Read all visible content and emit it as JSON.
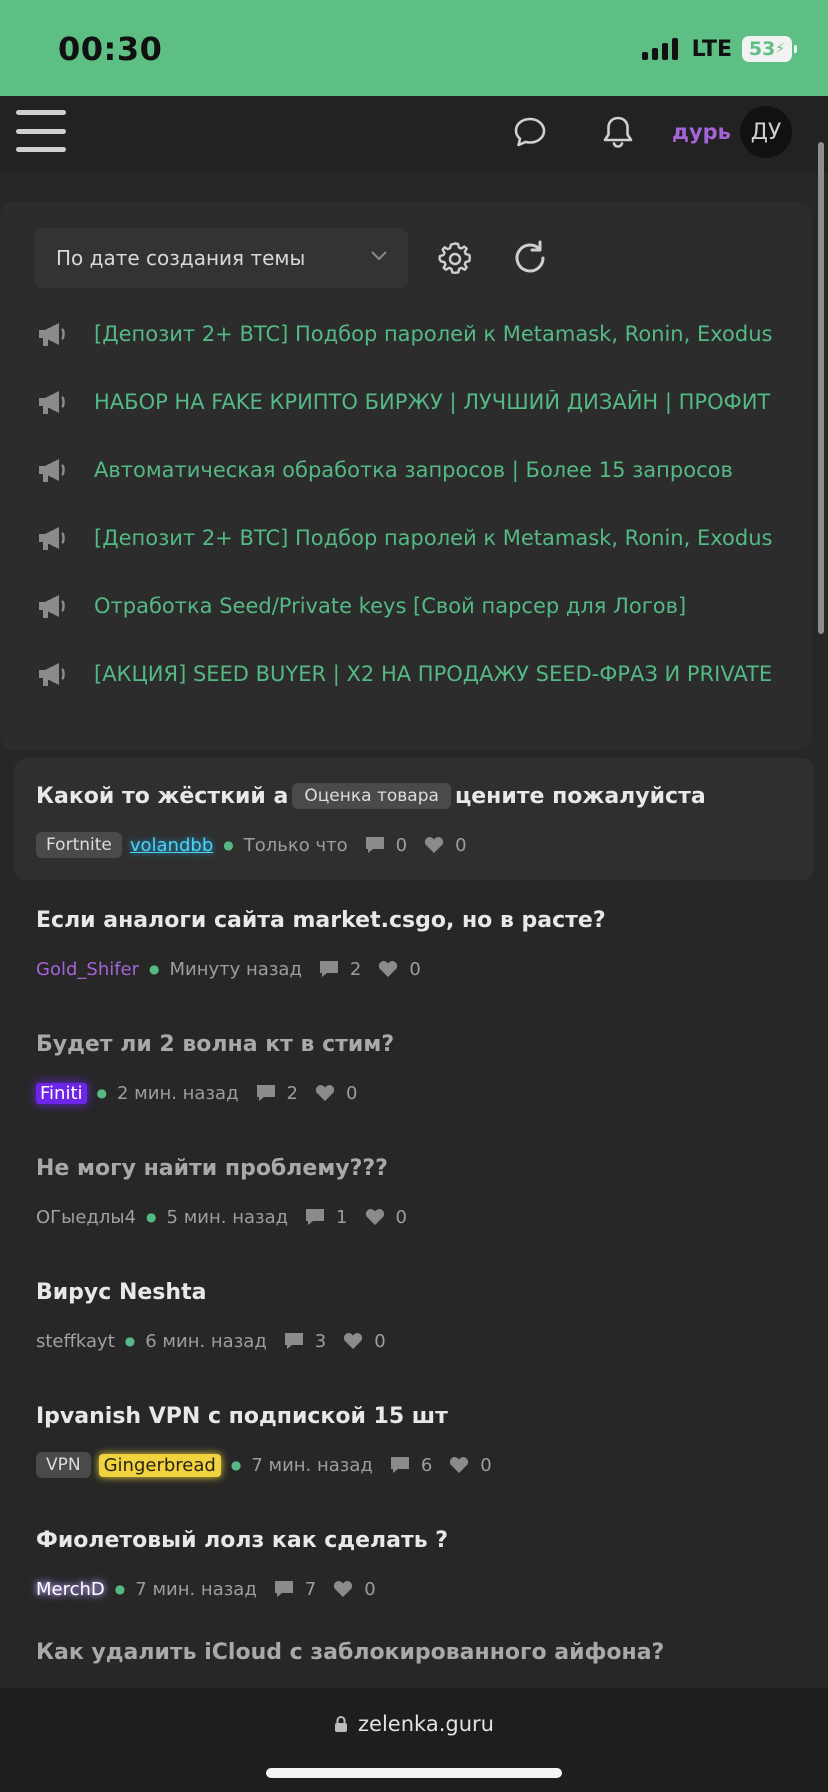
{
  "status_bar": {
    "time": "00:30",
    "network": "LTE",
    "battery": "53"
  },
  "header": {
    "username": "дурь",
    "avatar_initials": "ДУ"
  },
  "sort": {
    "label": "По дате создания темы"
  },
  "pinned": [
    "[Депозит 2+ BTC] Подбор паролей к Metamask, Ronin, Exodus",
    "НАБОР НА FAKE КРИПТО БИРЖУ | ЛУЧШИЙ ДИЗАЙН | ПРОФИТ",
    "Автоматическая обработка запросов | Более 15 запросов",
    "[Депозит 2+ BTC] Подбор паролей к Metamask, Ronin, Exodus",
    "Отработка Seed/Private keys [Свой парсер для Логов]",
    "[АКЦИЯ] SEED BUYER | X2 НА ПРОДАЖУ SEED-ФРАЗ И PRIVATE"
  ],
  "threads": [
    {
      "title_before": "Какой то жёсткий а",
      "inline_tag": "Оценка товара",
      "title_after": "цените пожалуйста",
      "tag": "Fortnite",
      "author": "volandbb",
      "time": "Только что",
      "replies": "0",
      "likes": "0"
    },
    {
      "title": "Если аналоги сайта market.csgo, но в расте?",
      "author": "Gold_Shifer",
      "time": "Минуту назад",
      "replies": "2",
      "likes": "0"
    },
    {
      "title": "Будет ли 2 волна кт в стим?",
      "author": "Finiti",
      "time": "2 мин. назад",
      "replies": "2",
      "likes": "0"
    },
    {
      "title": "Не могу найти проблему???",
      "author": "ОГыедлы4",
      "time": "5 мин. назад",
      "replies": "1",
      "likes": "0"
    },
    {
      "title": "Вирус Neshta",
      "author": "steffkayt",
      "time": "6 мин. назад",
      "replies": "3",
      "likes": "0"
    },
    {
      "title": "Ipvanish VPN с подпиской 15 шт",
      "tag": "VPN",
      "author": "Gingerbread",
      "time": "7 мин. назад",
      "replies": "6",
      "likes": "0"
    },
    {
      "title": "Фиолетовый лолз как сделать ?",
      "author": "MerchD",
      "time": "7 мин. назад",
      "replies": "7",
      "likes": "0"
    }
  ],
  "partial_thread": {
    "title": "Как удалить iCloud с заблокированного айфона?"
  },
  "browser": {
    "url": "zelenka.guru"
  },
  "colors": {
    "accent_green": "#54b983",
    "status_bar": "#5ebf84",
    "username_purple": "#a463d6"
  }
}
